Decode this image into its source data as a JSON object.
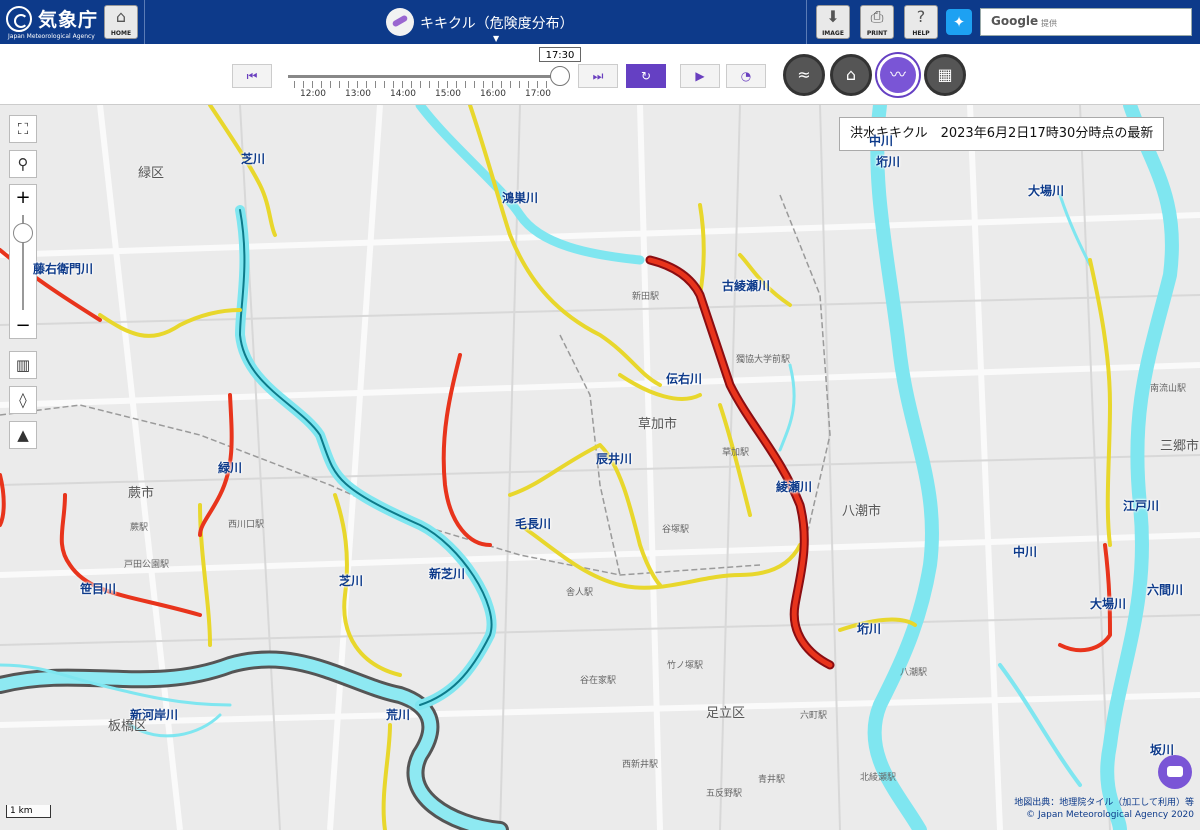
{
  "header": {
    "agency_name": "気象庁",
    "agency_name_en": "Japan Meteorological Agency",
    "home_label": "HOME",
    "page_title": "キキクル（危険度分布）",
    "image_label": "IMAGE",
    "print_label": "PRINT",
    "help_label": "HELP",
    "search_brand": "Google",
    "search_provided": "提供"
  },
  "timebar": {
    "current_time": "17:30",
    "ticks": [
      "12:00",
      "13:00",
      "14:00",
      "15:00",
      "16:00",
      "17:00"
    ],
    "progress": 1.0,
    "layers": [
      "flood-layer",
      "sediment-layer",
      "flood-kikikuru-layer",
      "map-layer"
    ],
    "active_layer": "flood-kikikuru-layer"
  },
  "map": {
    "info_text": "洪水キキクル　2023年6月2日17時30分時点の最新",
    "scale_label": "1 km",
    "attribution_1": "地図出典：地理院タイル（加工して利用）等",
    "attribution_2": "© Japan Meteorological Agency 2020",
    "river_labels": [
      "芝川",
      "鴻巣川",
      "古綾瀬川",
      "伝右川",
      "辰井川",
      "綾瀬川",
      "毛長川",
      "新芝川",
      "芝川",
      "笹目川",
      "緑川",
      "荒川",
      "新河岸川",
      "中川",
      "大場川",
      "大場川",
      "江戸川",
      "六間川",
      "垳川",
      "坂川",
      "垳川",
      "中川",
      "藤右衛門川"
    ],
    "place_labels": [
      "緑区",
      "蕨市",
      "草加市",
      "八潮市",
      "足立区",
      "板橋区",
      "三郷市"
    ],
    "station_labels": [
      "新田駅",
      "獨協大学前駅",
      "草加駅",
      "谷塚駅",
      "竹ノ塚駅",
      "六町駅",
      "西川口駅",
      "蕨駅",
      "戸田公園駅",
      "舎人駅",
      "谷在家駅",
      "西新井駅",
      "五反野駅",
      "青井駅",
      "北綾瀬駅",
      "南流山駅",
      "八潮駅"
    ],
    "colors": {
      "bg": "#ebebeb",
      "river_normal": "#7fe6f0",
      "river_yellow": "#e8d72c",
      "river_red": "#e8341c",
      "river_darkred": "#b2121a"
    }
  }
}
